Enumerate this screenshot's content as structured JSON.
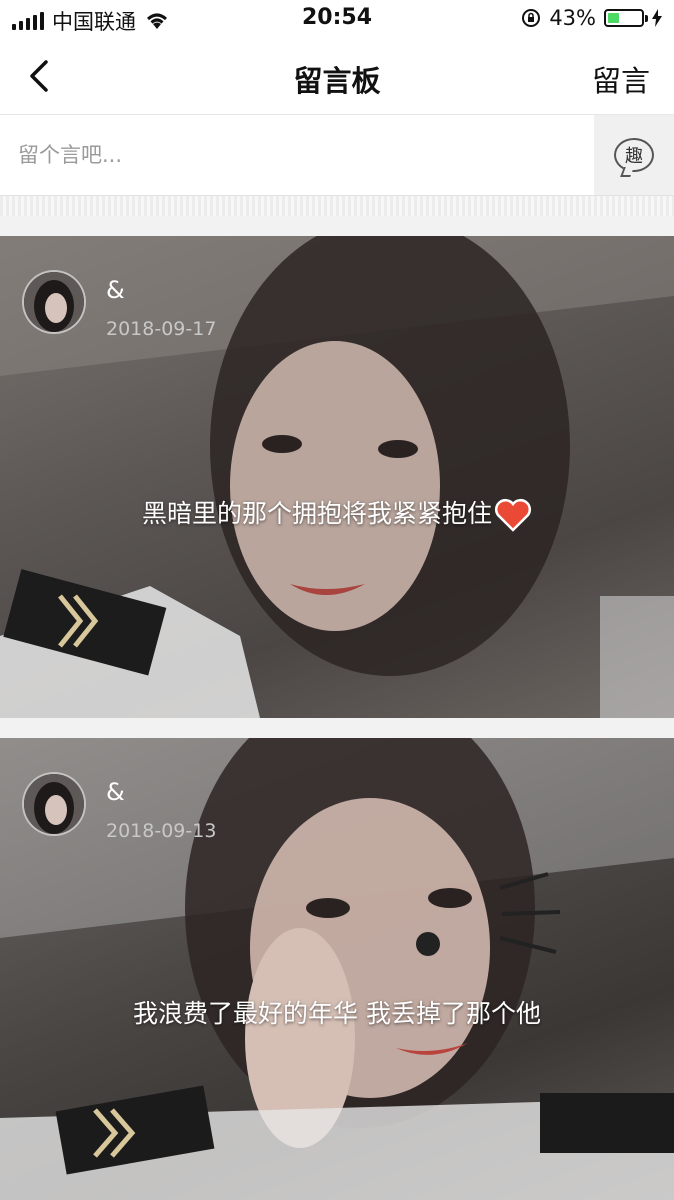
{
  "status_bar": {
    "carrier": "中国联通",
    "time": "20:54",
    "battery": "43%",
    "battery_level": 0.43
  },
  "nav": {
    "title": "留言板",
    "action_label": "留言"
  },
  "compose": {
    "placeholder": "留个言吧...",
    "fun_icon_label": "趣"
  },
  "messages": [
    {
      "username": "&",
      "date": "2018-09-17",
      "text": "黑暗里的那个拥抱将我紧紧抱住",
      "emoji": "heart-icon"
    },
    {
      "username": "&",
      "date": "2018-09-13",
      "text": "我浪费了最好的年华 我丢掉了那个他"
    }
  ]
}
